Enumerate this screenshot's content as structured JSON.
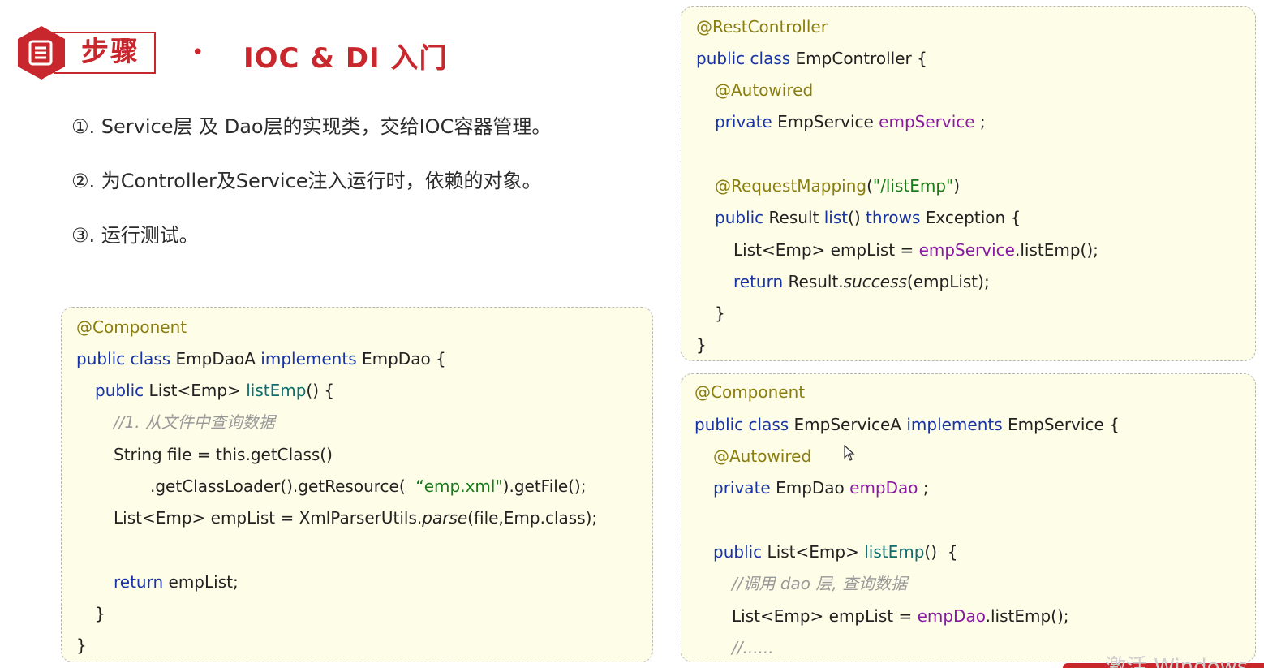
{
  "header": {
    "step_label": "步骤",
    "bullet": "•",
    "title": "IOC & DI 入门"
  },
  "steps": [
    "①. Service层 及 Dao层的实现类，交给IOC容器管理。",
    "②. 为Controller及Service注入运行时，依赖的对象。",
    "③. 运行测试。"
  ],
  "code_dao": {
    "annotation": "@Component",
    "kw_public_class": "public class",
    "class_name": " EmpDaoA ",
    "kw_implements": "implements",
    "iface": " EmpDao {",
    "kw_public": "public",
    "ret_type": " List<Emp> ",
    "method": "listEmp",
    "method_tail": "() {",
    "comment": "//1. 从文件中查询数据",
    "line_file": "String file = this.getClass()",
    "line_loader_a": ".getClassLoader().getResource(  ",
    "line_loader_str": "“emp.xml\"",
    "line_loader_b": ").getFile();",
    "line_list_a": "List<Emp> empList = XmlParserUtils.",
    "line_list_it": "parse",
    "line_list_b": "(file,Emp.class);",
    "kw_return": "return",
    "return_tail": " empList;",
    "close_inner": "}",
    "close_outer": "}"
  },
  "code_ctrl": {
    "annotation": "@RestController",
    "kw_public_class": "public class",
    "class_tail": " EmpController {",
    "autowired": "@Autowired",
    "kw_private": "private",
    "field_type": " EmpService ",
    "field_name": "empService",
    "field_tail": " ;",
    "mapping_ann": "@RequestMapping",
    "mapping_open": "(",
    "mapping_str": "\"/listEmp\"",
    "mapping_close": ")",
    "kw_public": "public",
    "ret_type": " Result ",
    "method": "list",
    "method_mid": "() ",
    "kw_throws": "throws",
    "throws_tail": " Exception {",
    "body_a": "List<Emp> empList = ",
    "body_field": "empService",
    "body_b": ".listEmp();",
    "kw_return": "return",
    "return_a": " Result.",
    "return_it": "success",
    "return_b": "(empList);",
    "close_inner": "}",
    "close_outer": "}"
  },
  "code_svc": {
    "annotation": "@Component",
    "kw_public_class": "public class",
    "class_name": " EmpServiceA ",
    "kw_implements": "implements",
    "iface": " EmpService {",
    "autowired": "@Autowired",
    "kw_private": "private",
    "field_type": " EmpDao ",
    "field_name": "empDao",
    "field_tail": " ;",
    "kw_public": "public",
    "ret_type": " List<Emp> ",
    "method": "listEmp",
    "method_tail": "()  {",
    "comment": "//调用 dao 层, 查询数据",
    "body_a": "List<Emp> empList = ",
    "body_field": "empDao",
    "body_b": ".listEmp();",
    "ellipsis": "//......"
  },
  "watermark": "激活 Windows",
  "colors": {
    "accent": "#c8272d",
    "code_bg": "#fdfde8",
    "keyword": "#1833a6",
    "annotation": "#8a7d10",
    "field": "#8b1aa3"
  }
}
